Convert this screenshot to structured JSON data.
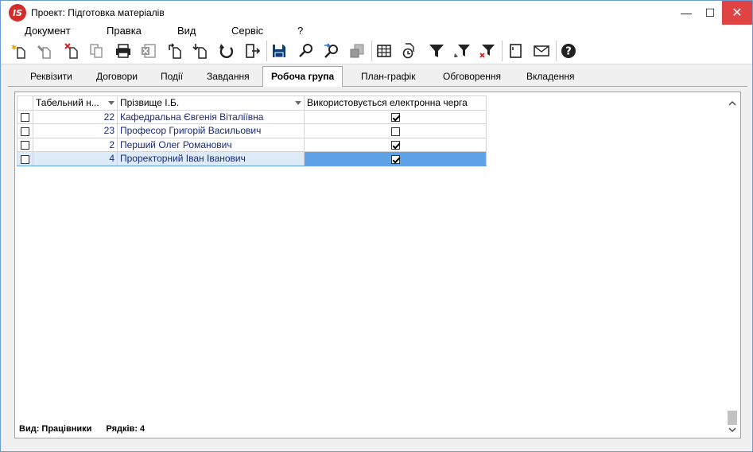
{
  "window": {
    "title": "Проект: Підготовка матеріалів",
    "logo_text": "IS",
    "controls": {
      "minimize": "—",
      "maximize": "☐",
      "close": "✕"
    }
  },
  "menu": {
    "items": [
      "Документ",
      "Правка",
      "Вид",
      "Сервіс",
      "?"
    ]
  },
  "toolbar": {
    "buttons": [
      "new-document-icon",
      "edit-document-icon",
      "delete-document-icon",
      "copy-document-icon",
      "print-icon",
      "export-excel-icon",
      "move-document-icon",
      "insert-document-icon",
      "refresh-icon",
      "exit-icon",
      "save-icon",
      "search-icon",
      "search-next-icon",
      "database-icon",
      "table-icon",
      "history-icon",
      "filter-icon",
      "filter-edit-icon",
      "filter-clear-icon",
      "note-icon",
      "mail-icon",
      "help-icon"
    ]
  },
  "tabs": [
    {
      "label": "Реквізити",
      "active": false
    },
    {
      "label": "Договори",
      "active": false
    },
    {
      "label": "Події",
      "active": false
    },
    {
      "label": "Завдання",
      "active": false
    },
    {
      "label": "Робоча група",
      "active": true
    },
    {
      "label": "План-графік",
      "active": false
    },
    {
      "label": "Обговорення",
      "active": false
    },
    {
      "label": "Вкладення",
      "active": false
    }
  ],
  "grid": {
    "columns": {
      "number": "Табельний н...",
      "name": "Прізвище І.Б.",
      "queue": "Використовується електронна черга"
    },
    "rows": [
      {
        "number": "22",
        "name": "Кафедральна Євгенія Віталіївна",
        "queue": true,
        "selected": false
      },
      {
        "number": "23",
        "name": "Професор Григорій Васильович",
        "queue": false,
        "selected": false
      },
      {
        "number": "2",
        "name": "Перший Олег Романович",
        "queue": true,
        "selected": false
      },
      {
        "number": "4",
        "name": "Проректорний Іван Іванович",
        "queue": true,
        "selected": true
      }
    ]
  },
  "status": {
    "view": "Вид: Працівники",
    "rows": "Рядків: 4"
  }
}
